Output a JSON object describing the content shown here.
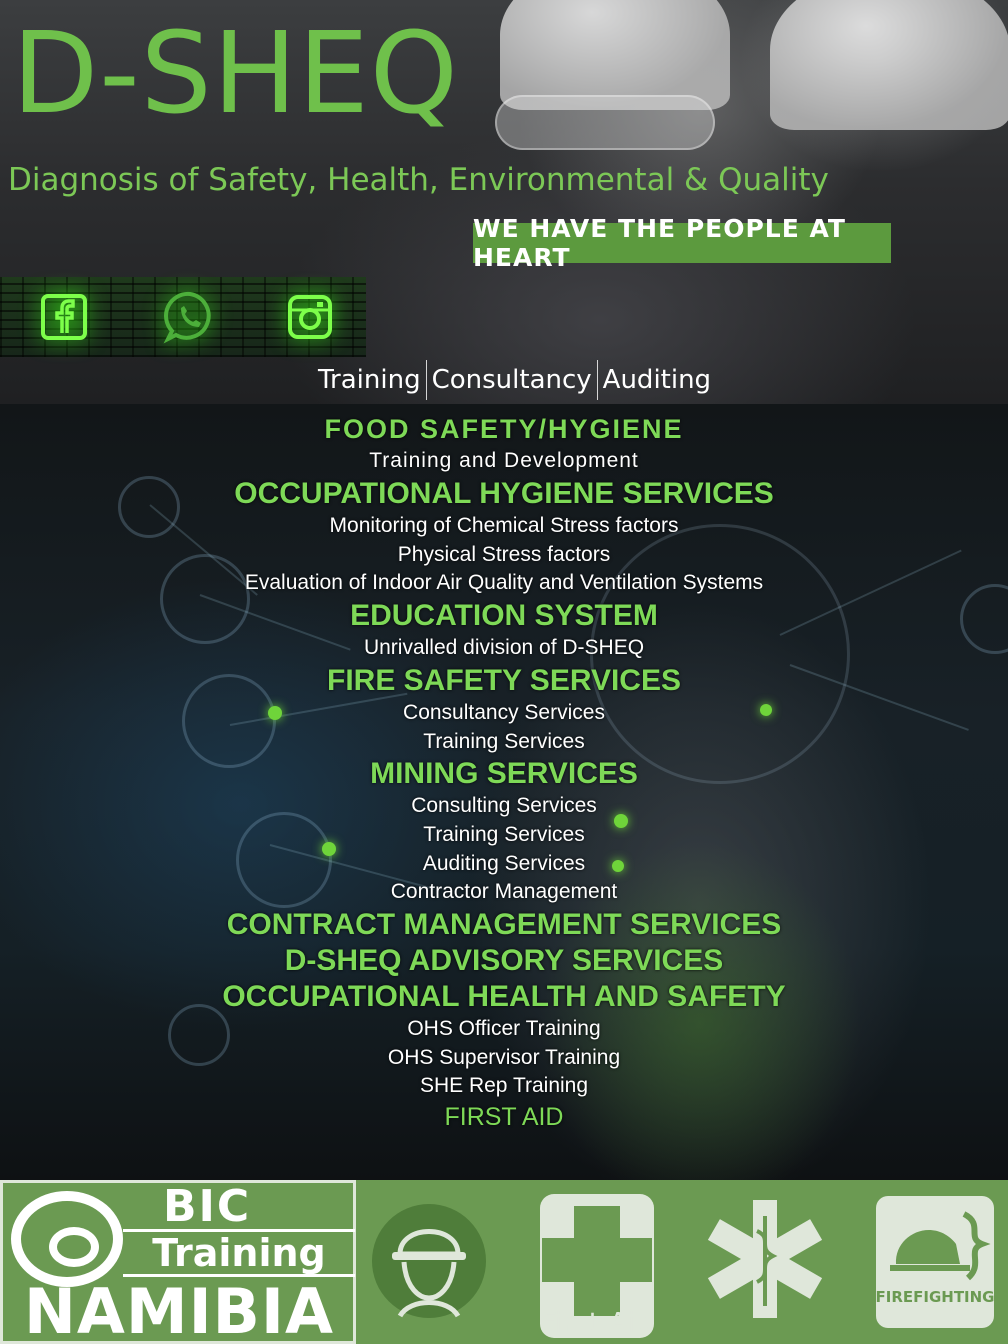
{
  "header": {
    "brand": "D-SHEQ",
    "tagline": "Diagnosis of Safety, Health, Environmental & Quality",
    "motto": "WE HAVE THE PEOPLE AT HEART",
    "social": [
      {
        "icon": "facebook-icon"
      },
      {
        "icon": "whatsapp-icon"
      },
      {
        "icon": "instagram-icon"
      }
    ],
    "menu": [
      "Training",
      "Consultancy",
      "Auditing"
    ]
  },
  "services": {
    "food": {
      "title": "FOOD SAFETY/HYGIENE",
      "items": [
        "Training and Development"
      ]
    },
    "occ_hygiene": {
      "title": "OCCUPATIONAL HYGIENE SERVICES",
      "items": [
        "Monitoring of Chemical Stress factors",
        "Physical Stress factors",
        "Evaluation of Indoor Air Quality and Ventilation Systems"
      ]
    },
    "education": {
      "title": "EDUCATION SYSTEM",
      "items": [
        "Unrivalled division of D-SHEQ"
      ]
    },
    "fire": {
      "title": "FIRE SAFETY SERVICES",
      "items": [
        "Consultancy Services",
        "Training Services"
      ]
    },
    "mining": {
      "title": "MINING SERVICES",
      "items": [
        "Consulting Services",
        "Training Services",
        "Auditing Services",
        "Contractor Management"
      ]
    },
    "contract": {
      "title": "CONTRACT MANAGEMENT SERVICES"
    },
    "advisory": {
      "title": "D-SHEQ ADVISORY SERVICES"
    },
    "ohs": {
      "title": "OCCUPATIONAL HEALTH AND SAFETY",
      "items": [
        "OHS Officer Training",
        "OHS Supervisor Training",
        "SHE Rep Training"
      ]
    },
    "first_aid": "FIRST AID"
  },
  "footer": {
    "bic_word": "BIC",
    "bic_training": "Training",
    "bic_namibia": "NAMIBIA",
    "first_aid_label": "First Aid",
    "firefighting_label": "FIREFIGHTING",
    "colors": {
      "green": "#6b9a52",
      "accent": "#6fc04b"
    }
  }
}
